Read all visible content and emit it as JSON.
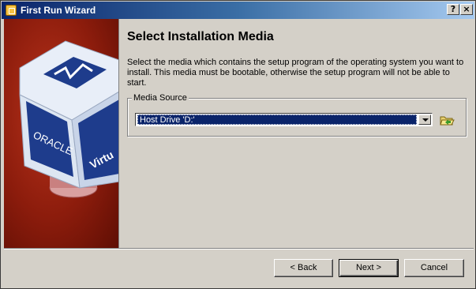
{
  "window": {
    "title": "First Run Wizard",
    "help_label": "?",
    "close_label": "×"
  },
  "sidepanel": {
    "logo_text_1": "ORACLE",
    "logo_text_2": "Virtu"
  },
  "page": {
    "heading": "Select Installation Media",
    "description": "Select the media which contains the setup program of the operating system you want to install. This media must be bootable, otherwise the setup program will not be able to start."
  },
  "media_source": {
    "legend": "Media Source",
    "selected": "Host Drive 'D:'"
  },
  "buttons": {
    "back": "< Back",
    "next": "Next >",
    "cancel": "Cancel"
  },
  "colors": {
    "accent": "#0a246a",
    "panel": "#8c1c0c",
    "face": "#d4d0c8"
  }
}
